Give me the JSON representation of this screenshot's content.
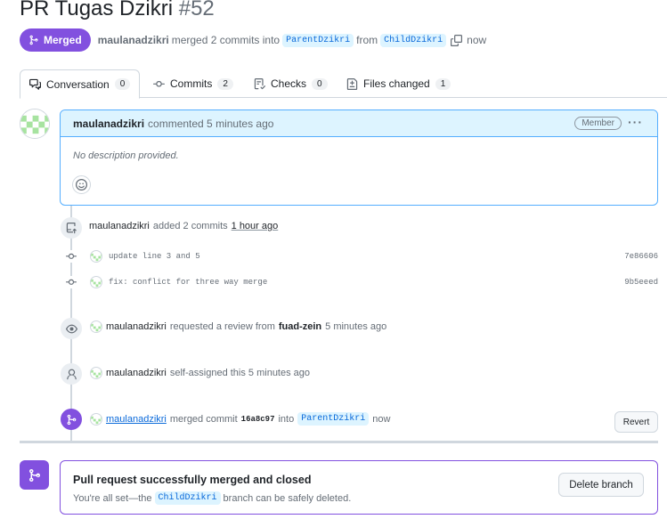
{
  "pr": {
    "title": "PR Tugas Dzikri",
    "number": "#52",
    "state": "Merged",
    "author": "maulanadzikri",
    "merge_text": "merged 2 commits into",
    "base_branch": "ParentDzikri",
    "from_text": "from",
    "head_branch": "ChildDzikri",
    "when": "now"
  },
  "tabs": [
    {
      "label": "Conversation",
      "count": "0",
      "icon": "comment-discussion-icon"
    },
    {
      "label": "Commits",
      "count": "2",
      "icon": "git-commit-icon"
    },
    {
      "label": "Checks",
      "count": "0",
      "icon": "checklist-icon"
    },
    {
      "label": "Files changed",
      "count": "1",
      "icon": "file-diff-icon"
    }
  ],
  "comment": {
    "author": "maulanadzikri",
    "action": "commented 5 minutes ago",
    "role_badge": "Member",
    "menu": "···",
    "body": "No description provided."
  },
  "timeline": {
    "commits_event": {
      "author": "maulanadzikri",
      "text": "added 2 commits",
      "time": "1 hour ago"
    },
    "commits": [
      {
        "message": "update line 3 and 5",
        "sha": "7e86606"
      },
      {
        "message": "fix: conflict for three way merge",
        "sha": "9b5eeed"
      }
    ],
    "review_event": {
      "author": "maulanadzikri",
      "text": "requested a review from",
      "reviewer": "fuad-zein",
      "time": "5 minutes ago"
    },
    "assign_event": {
      "author": "maulanadzikri",
      "text": "self-assigned this 5 minutes ago"
    },
    "merge_event": {
      "author": "maulanadzikri",
      "text": "merged commit",
      "sha": "16a8c97",
      "into": "into",
      "branch": "ParentDzikri",
      "time": "now",
      "revert_label": "Revert"
    }
  },
  "merge_box": {
    "title": "Pull request successfully merged and closed",
    "sub_prefix": "You're all set—the",
    "branch": "ChildDzikri",
    "sub_suffix": "branch can be safely deleted.",
    "delete_label": "Delete branch"
  },
  "colors": {
    "merged": "#8250df",
    "link": "#0969da",
    "comment_border": "#54aeff",
    "comment_header": "#ddf4ff"
  }
}
